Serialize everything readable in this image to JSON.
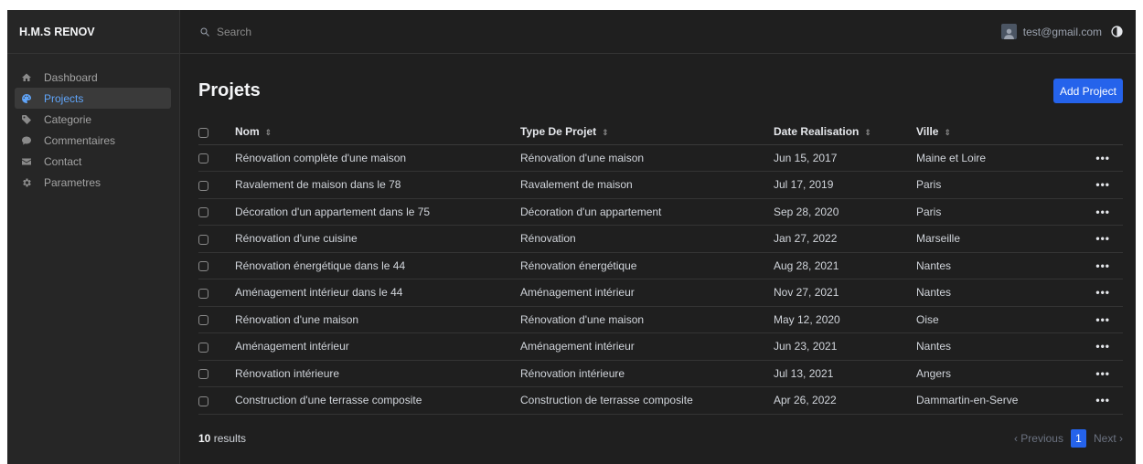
{
  "app": {
    "brand": "H.M.S RENOV"
  },
  "sidebar": {
    "items": [
      {
        "label": "Dashboard",
        "icon": "home-icon"
      },
      {
        "label": "Projects",
        "icon": "palette-icon",
        "active": true
      },
      {
        "label": "Categorie",
        "icon": "tag-icon"
      },
      {
        "label": "Commentaires",
        "icon": "comment-icon"
      },
      {
        "label": "Contact",
        "icon": "envelope-icon"
      },
      {
        "label": "Parametres",
        "icon": "gear-icon"
      }
    ]
  },
  "topbar": {
    "search_placeholder": "Search",
    "user_email": "test@gmail.com"
  },
  "page": {
    "title": "Projets",
    "add_button": "Add Project"
  },
  "table": {
    "columns": [
      "Nom",
      "Type De Projet",
      "Date Realisation",
      "Ville"
    ],
    "rows": [
      [
        "Rénovation complète d'une maison",
        "Rénovation d'une maison",
        "Jun 15, 2017",
        "Maine et Loire"
      ],
      [
        "Ravalement de maison dans le 78",
        "Ravalement de maison",
        "Jul 17, 2019",
        "Paris"
      ],
      [
        "Décoration d'un appartement dans le 75",
        "Décoration d'un appartement",
        "Sep 28, 2020",
        "Paris"
      ],
      [
        "Rénovation d'une cuisine",
        "Rénovation",
        "Jan 27, 2022",
        "Marseille"
      ],
      [
        "Rénovation énergétique dans le 44",
        "Rénovation énergétique",
        "Aug 28, 2021",
        "Nantes"
      ],
      [
        "Aménagement intérieur dans le 44",
        "Aménagement intérieur",
        "Nov 27, 2021",
        "Nantes"
      ],
      [
        "Rénovation d'une maison",
        "Rénovation d'une maison",
        "May 12, 2020",
        "Oise"
      ],
      [
        "Aménagement intérieur",
        "Aménagement intérieur",
        "Jun 23, 2021",
        "Nantes"
      ],
      [
        "Rénovation intérieure",
        "Rénovation intérieure",
        "Jul 13, 2021",
        "Angers"
      ],
      [
        "Construction d'une terrasse composite",
        "Construction de terrasse composite",
        "Apr 26, 2022",
        "Dammartin-en-Serve"
      ]
    ]
  },
  "footer": {
    "results_count": "10",
    "results_label": " results",
    "prev": "‹ Previous",
    "page": "1",
    "next": "Next ›"
  },
  "colors": {
    "accent": "#2563eb",
    "active_nav": "#60a5fa",
    "background": "#1f1f1f",
    "sidebar": "#262626"
  }
}
